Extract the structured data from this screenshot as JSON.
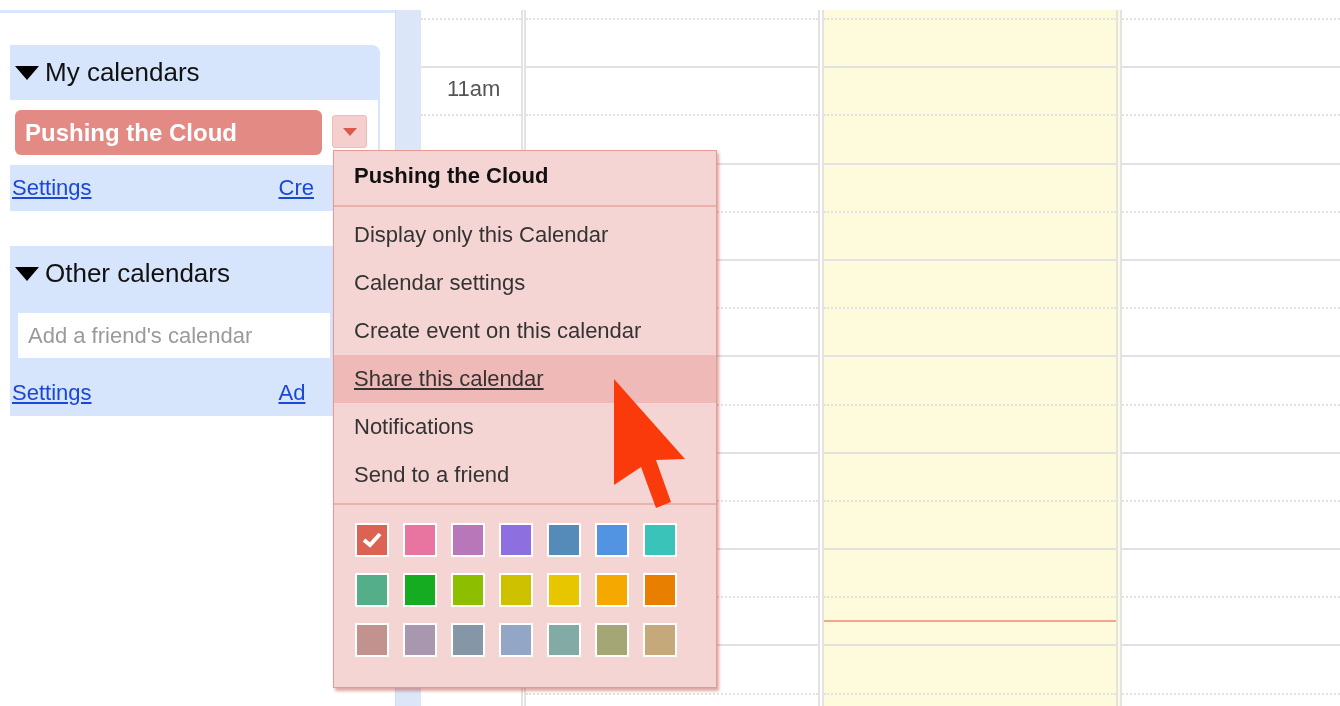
{
  "sidebar": {
    "sections": [
      {
        "title": "My calendars",
        "expanded": true,
        "calendars": [
          {
            "name": "Pushing the Cloud",
            "color": "#e48a84"
          }
        ],
        "links": [
          "Settings",
          "Cre"
        ]
      },
      {
        "title": "Other calendars",
        "expanded": true,
        "field": {
          "placeholder": "Add a friend's calendar"
        },
        "links": [
          "Settings",
          "Ad"
        ]
      }
    ]
  },
  "time_labels": [
    "11am"
  ],
  "day_columns": [
    {
      "today": false
    },
    {
      "today": true
    },
    {
      "today": false
    }
  ],
  "menu": {
    "title": "Pushing the Cloud",
    "items": [
      {
        "label": "Display only this Calendar",
        "highlighted": false
      },
      {
        "label": "Calendar settings",
        "highlighted": false
      },
      {
        "label": "Create event on this calendar",
        "highlighted": false
      },
      {
        "label": "Share this calendar",
        "highlighted": true
      },
      {
        "label": "Notifications",
        "highlighted": false
      },
      {
        "label": "Send to a friend",
        "highlighted": false
      }
    ],
    "swatches": [
      {
        "color": "#dc6353",
        "checked": true
      },
      {
        "color": "#e8759f",
        "checked": false
      },
      {
        "color": "#b877b9",
        "checked": false
      },
      {
        "color": "#8d6fe0",
        "checked": false
      },
      {
        "color": "#548bb8",
        "checked": false
      },
      {
        "color": "#5294e2",
        "checked": false
      },
      {
        "color": "#39c3b9",
        "checked": false
      },
      {
        "color": "#54ae8a",
        "checked": false
      },
      {
        "color": "#16ac22",
        "checked": false
      },
      {
        "color": "#8dbe00",
        "checked": false
      },
      {
        "color": "#cdc100",
        "checked": false
      },
      {
        "color": "#e7c600",
        "checked": false
      },
      {
        "color": "#f5a800",
        "checked": false
      },
      {
        "color": "#e97f00",
        "checked": false
      },
      {
        "color": "#c2928f",
        "checked": false
      },
      {
        "color": "#a897af",
        "checked": false
      },
      {
        "color": "#8597a6",
        "checked": false
      },
      {
        "color": "#93a6c6",
        "checked": false
      },
      {
        "color": "#82aba6",
        "checked": false
      },
      {
        "color": "#a4a775",
        "checked": false
      },
      {
        "color": "#c6a97b",
        "checked": false
      }
    ]
  }
}
